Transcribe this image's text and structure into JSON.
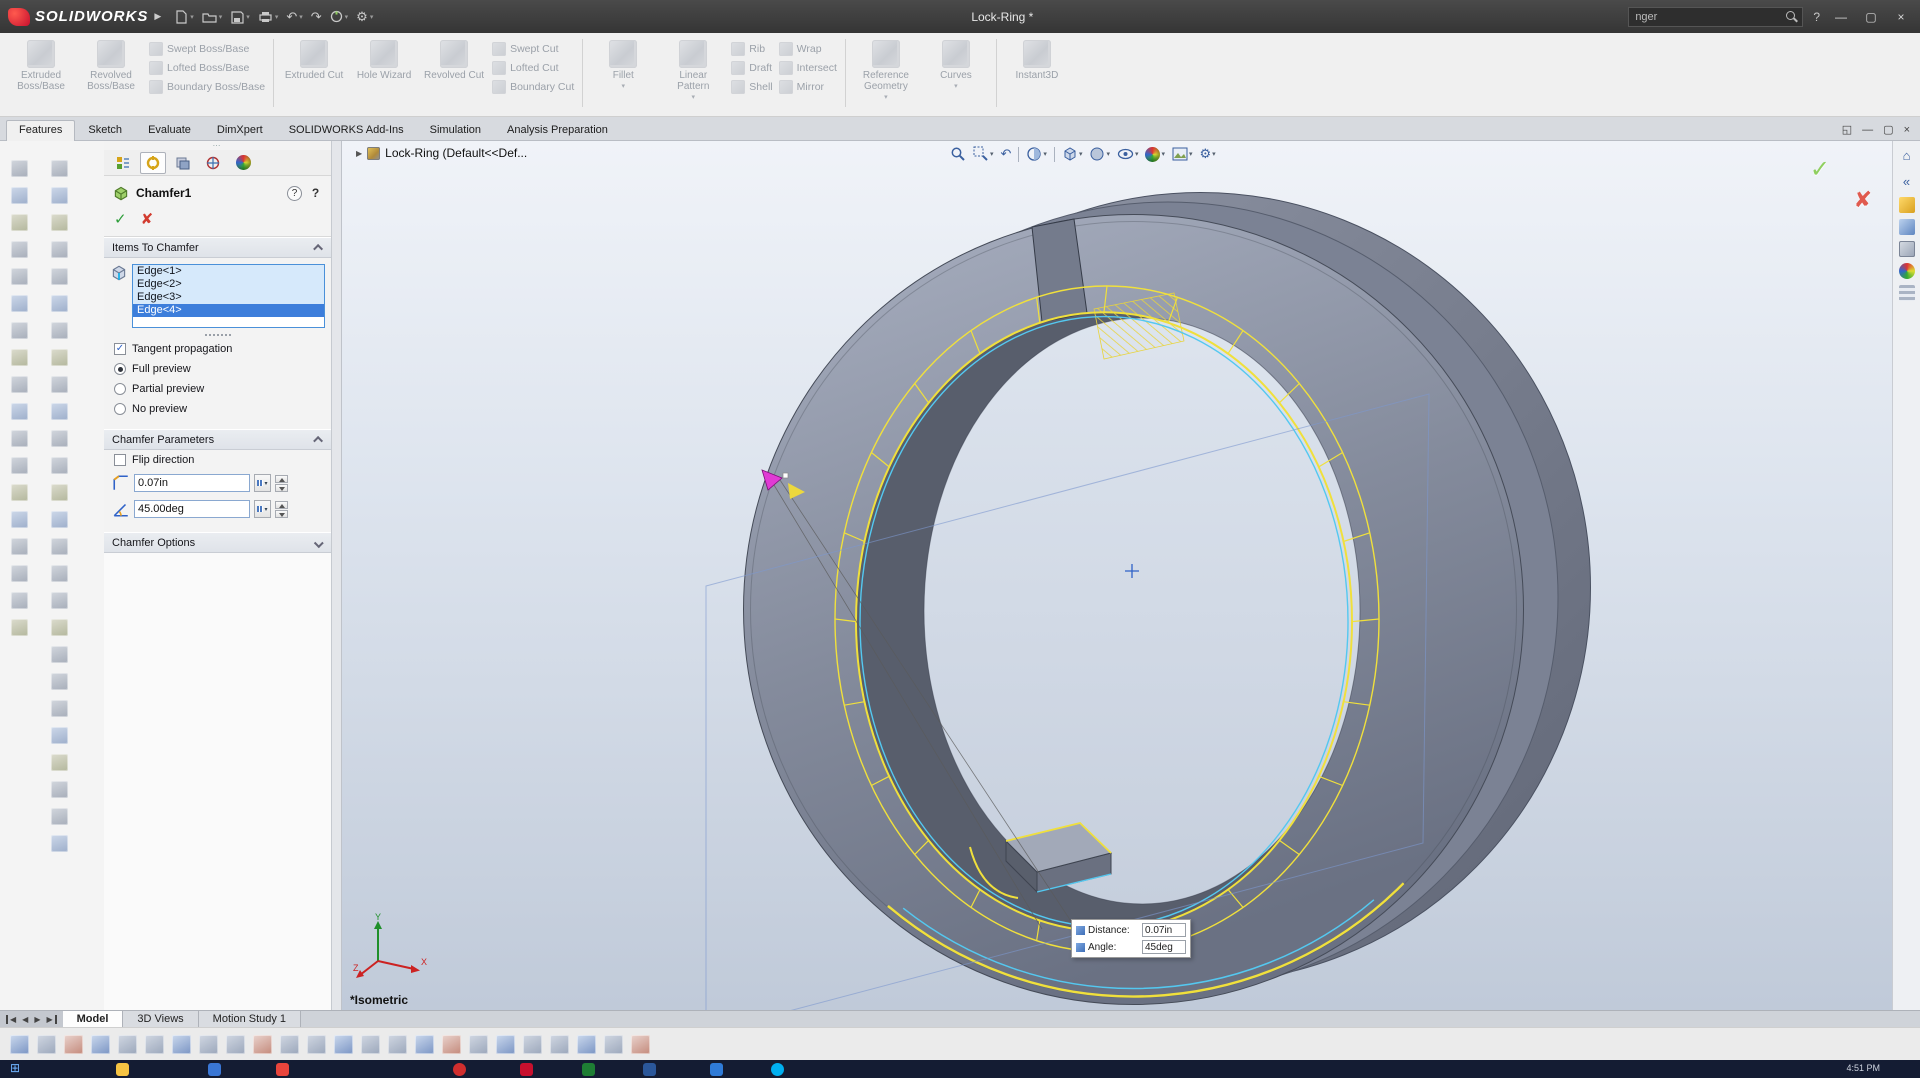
{
  "titlebar": {
    "logo_text": "SOLIDWORKS",
    "title": "Lock-Ring *",
    "search_value": "nger"
  },
  "icons": {
    "chevron_down": "▾",
    "check": "✓",
    "cross": "✘",
    "help": "?",
    "home": "⌂",
    "collapse": "«",
    "gear": "⚙",
    "undo": "↶",
    "redo": "↷",
    "close": "×",
    "minimize": "—",
    "restore": "▢",
    "dock": "◱",
    "prev": "◀",
    "next": "▶",
    "flyout": "▶",
    "start": "⊞",
    "grip": "⋯"
  },
  "ribbon": {
    "extruded_boss": "Extruded Boss/Base",
    "revolved_boss": "Revolved Boss/Base",
    "swept_boss": "Swept Boss/Base",
    "lofted_boss": "Lofted Boss/Base",
    "boundary_boss": "Boundary Boss/Base",
    "extruded_cut": "Extruded Cut",
    "hole_wizard": "Hole Wizard",
    "revolved_cut": "Revolved Cut",
    "swept_cut": "Swept Cut",
    "lofted_cut": "Lofted Cut",
    "boundary_cut": "Boundary Cut",
    "fillet": "Fillet",
    "linear_pattern": "Linear Pattern",
    "rib": "Rib",
    "draft": "Draft",
    "shell": "Shell",
    "wrap": "Wrap",
    "intersect": "Intersect",
    "mirror": "Mirror",
    "reference_geometry": "Reference Geometry",
    "curves": "Curves",
    "instant3d": "Instant3D"
  },
  "tabs": {
    "features": "Features",
    "sketch": "Sketch",
    "evaluate": "Evaluate",
    "dimxpert": "DimXpert",
    "addins": "SOLIDWORKS Add-Ins",
    "simulation": "Simulation",
    "analysis": "Analysis Preparation"
  },
  "pm": {
    "title": "Chamfer1",
    "items_header": "Items To Chamfer",
    "edges": [
      "Edge<1>",
      "Edge<2>",
      "Edge<3>",
      "Edge<4>"
    ],
    "tangent": "Tangent propagation",
    "full_preview": "Full preview",
    "partial_preview": "Partial preview",
    "no_preview": "No preview",
    "params_header": "Chamfer Parameters",
    "flip": "Flip direction",
    "distance": "0.07in",
    "angle": "45.00deg",
    "options_header": "Chamfer Options"
  },
  "viewport": {
    "tree_item": "Lock-Ring  (Default<<Def...",
    "view_name": "*Isometric",
    "tooltip": {
      "distance_label": "Distance:",
      "distance_value": "0.07in",
      "angle_label": "Angle:",
      "angle_value": "45deg"
    },
    "axis_x": "X",
    "axis_y": "Y",
    "axis_z": "Z"
  },
  "doc_tabs": {
    "model": "Model",
    "views3d": "3D Views",
    "motion": "Motion Study 1"
  },
  "taskbar": {
    "time": "4:51 PM"
  }
}
